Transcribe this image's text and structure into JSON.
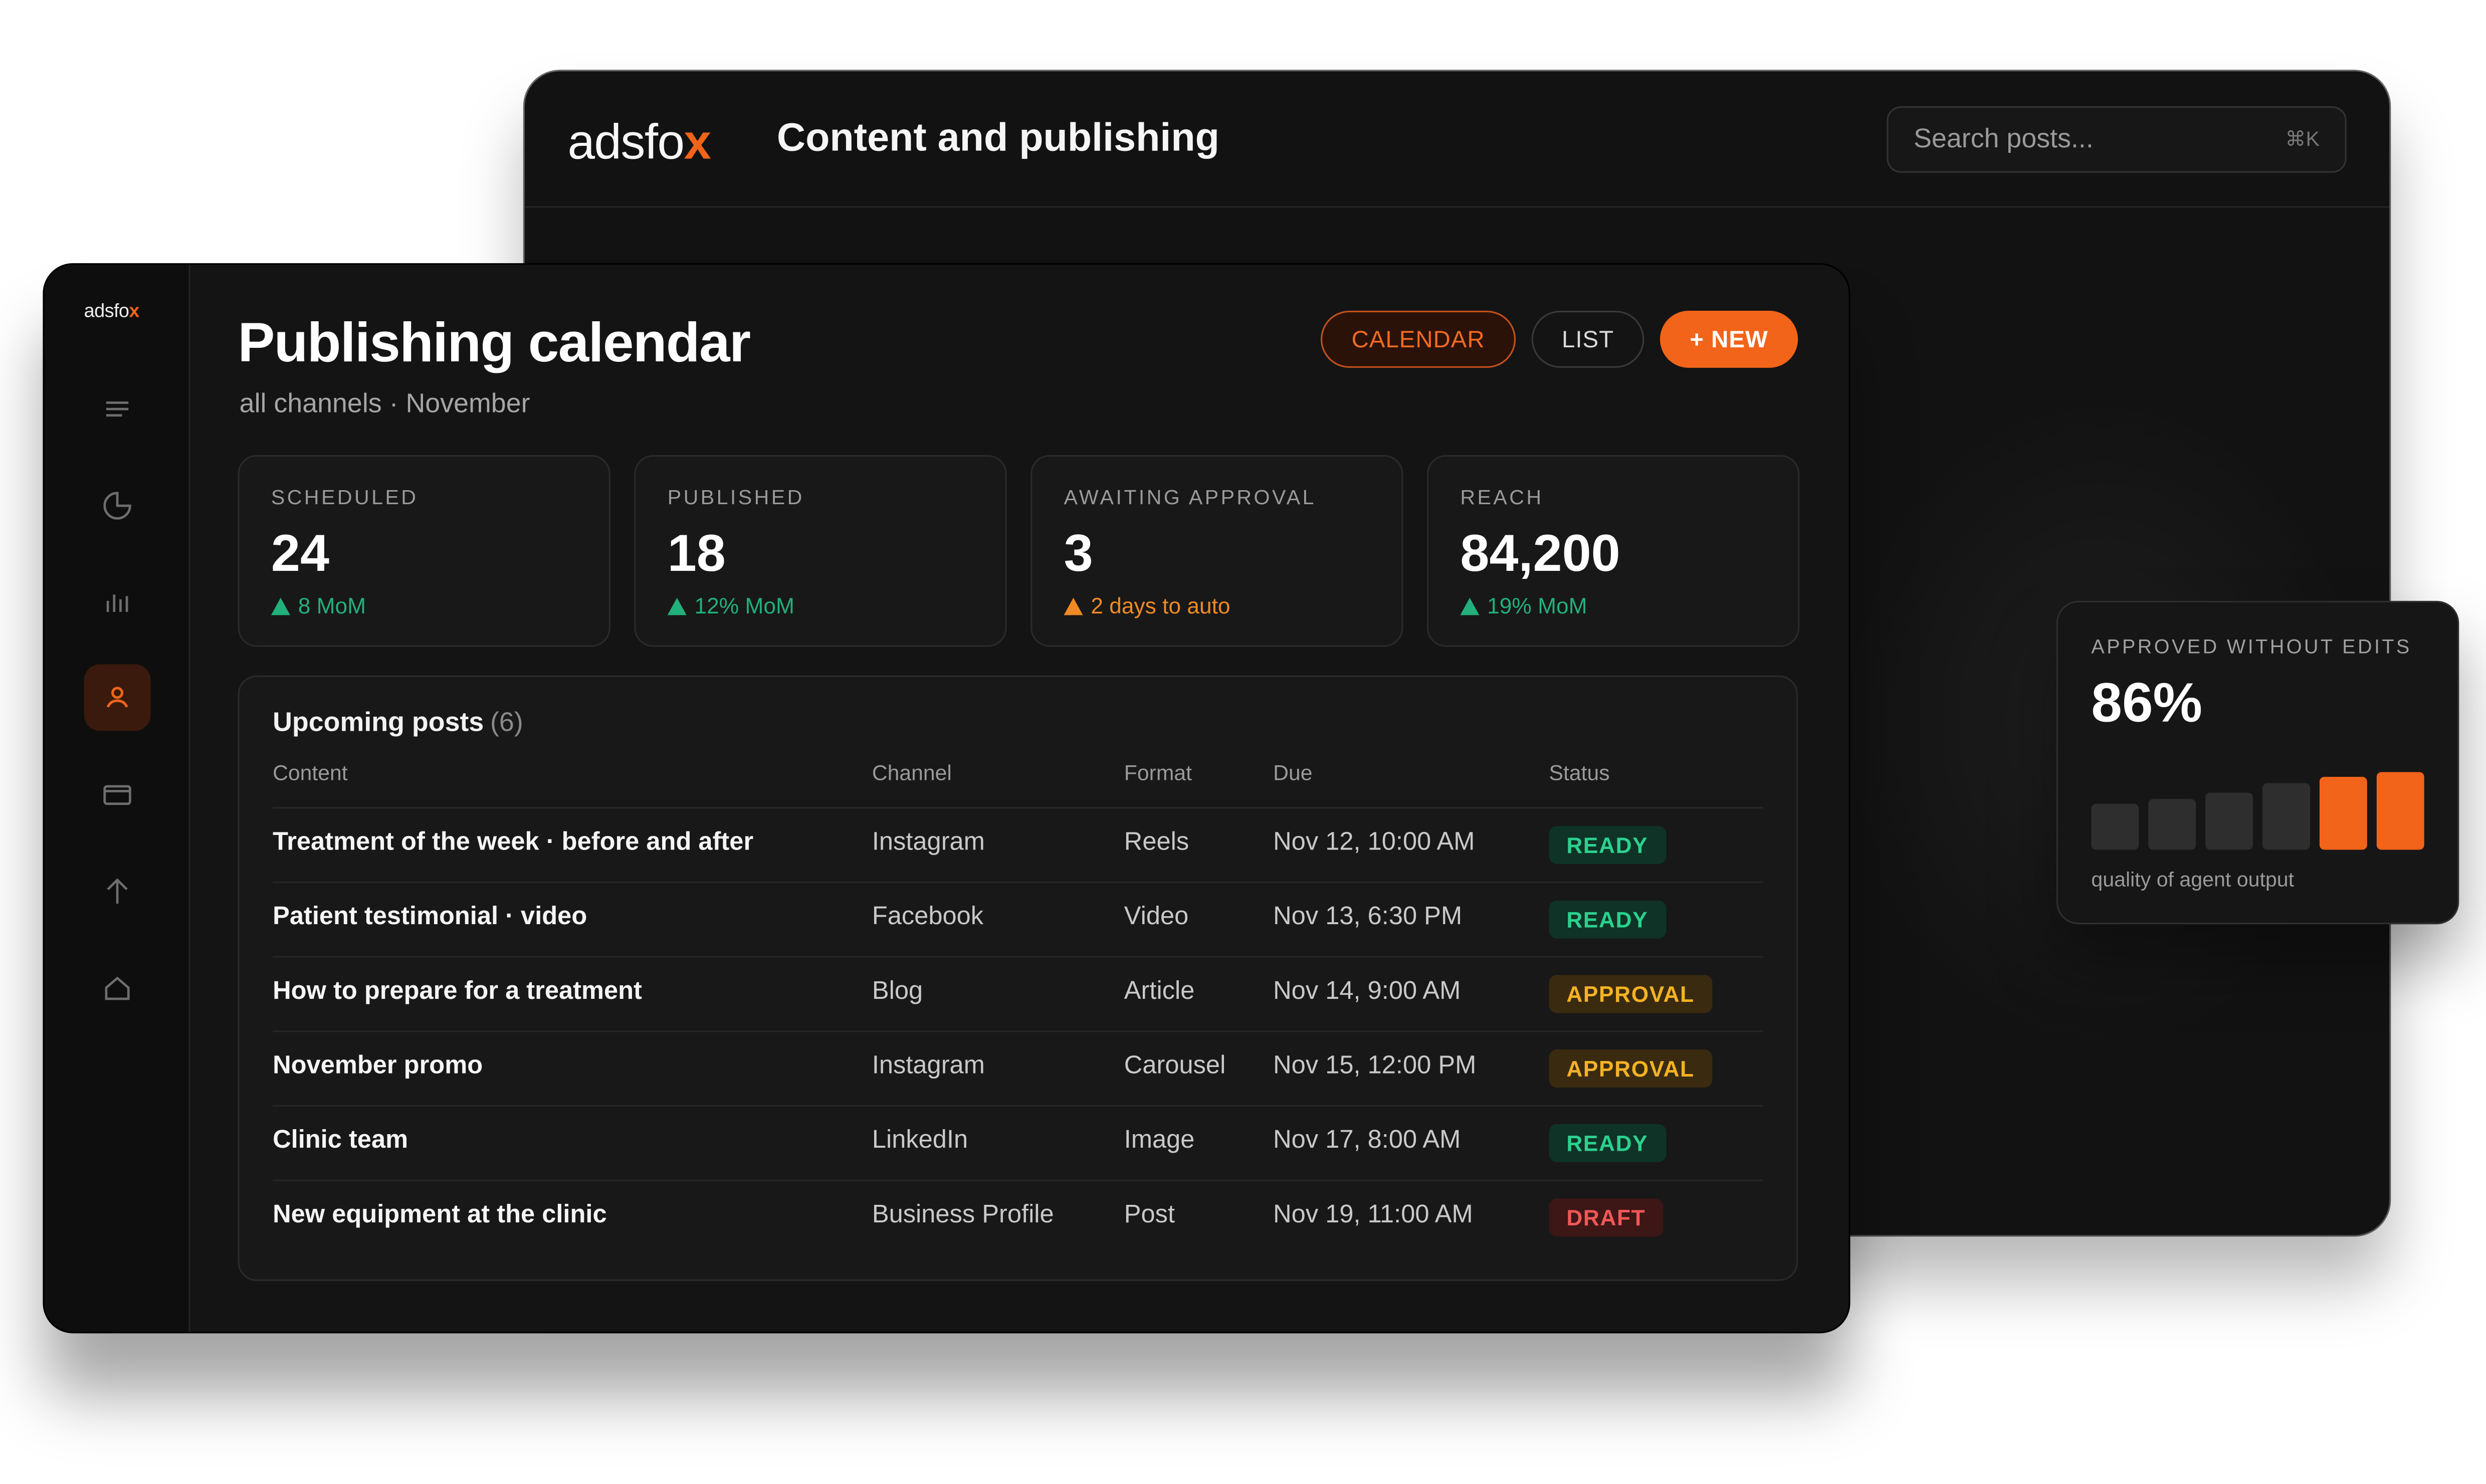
{
  "brand": {
    "name_prefix": "adsfo",
    "name_mark": "x",
    "accent": "#f26419"
  },
  "back_window": {
    "title": "Content and publishing",
    "search": {
      "placeholder": "Search posts...",
      "shortcut": "⌘K"
    }
  },
  "sidebar": {
    "items": [
      {
        "icon": "menu-icon",
        "active": false
      },
      {
        "icon": "pie-chart-icon",
        "active": false
      },
      {
        "icon": "bar-chart-icon",
        "active": false
      },
      {
        "icon": "user-icon",
        "active": true
      },
      {
        "icon": "card-icon",
        "active": false
      },
      {
        "icon": "arrow-up-icon",
        "active": false
      },
      {
        "icon": "home-icon",
        "active": false
      }
    ]
  },
  "page": {
    "title": "Publishing calendar",
    "subtitle": "all channels · November",
    "buttons": {
      "calendar": "CALENDAR",
      "list": "LIST",
      "new": "+ NEW"
    }
  },
  "stats": [
    {
      "label": "SCHEDULED",
      "value": "24",
      "delta": "8 MoM",
      "tone": "green"
    },
    {
      "label": "PUBLISHED",
      "value": "18",
      "delta": "12% MoM",
      "tone": "green"
    },
    {
      "label": "AWAITING APPROVAL",
      "value": "3",
      "delta": "2 days to auto",
      "tone": "orange"
    },
    {
      "label": "REACH",
      "value": "84,200",
      "delta": "19% MoM",
      "tone": "green"
    }
  ],
  "posts": {
    "title": "Upcoming posts",
    "count": "(6)",
    "columns": [
      "Content",
      "Channel",
      "Format",
      "Due",
      "Status"
    ],
    "rows": [
      {
        "content": "Treatment of the week · before and after",
        "channel": "Instagram",
        "format": "Reels",
        "due": "Nov 12, 10:00 AM",
        "status": "READY",
        "kind": "ready"
      },
      {
        "content": "Patient testimonial · video",
        "channel": "Facebook",
        "format": "Video",
        "due": "Nov 13, 6:30 PM",
        "status": "READY",
        "kind": "ready"
      },
      {
        "content": "How to prepare for a treatment",
        "channel": "Blog",
        "format": "Article",
        "due": "Nov 14, 9:00 AM",
        "status": "APPROVAL",
        "kind": "approval"
      },
      {
        "content": "November promo",
        "channel": "Instagram",
        "format": "Carousel",
        "due": "Nov 15, 12:00 PM",
        "status": "APPROVAL",
        "kind": "approval"
      },
      {
        "content": "Clinic team",
        "channel": "LinkedIn",
        "format": "Image",
        "due": "Nov 17, 8:00 AM",
        "status": "READY",
        "kind": "ready"
      },
      {
        "content": "New equipment at the clinic",
        "channel": "Business Profile",
        "format": "Post",
        "due": "Nov 19, 11:00 AM",
        "status": "DRAFT",
        "kind": "draft"
      }
    ]
  },
  "quality_card": {
    "label": "APPROVED WITHOUT EDITS",
    "value": "86%",
    "caption": "quality of agent output",
    "bar_levels": [
      0.55,
      0.62,
      0.7,
      0.8,
      0.88,
      0.94
    ],
    "bar_highlight": [
      false,
      false,
      false,
      false,
      true,
      true
    ]
  }
}
